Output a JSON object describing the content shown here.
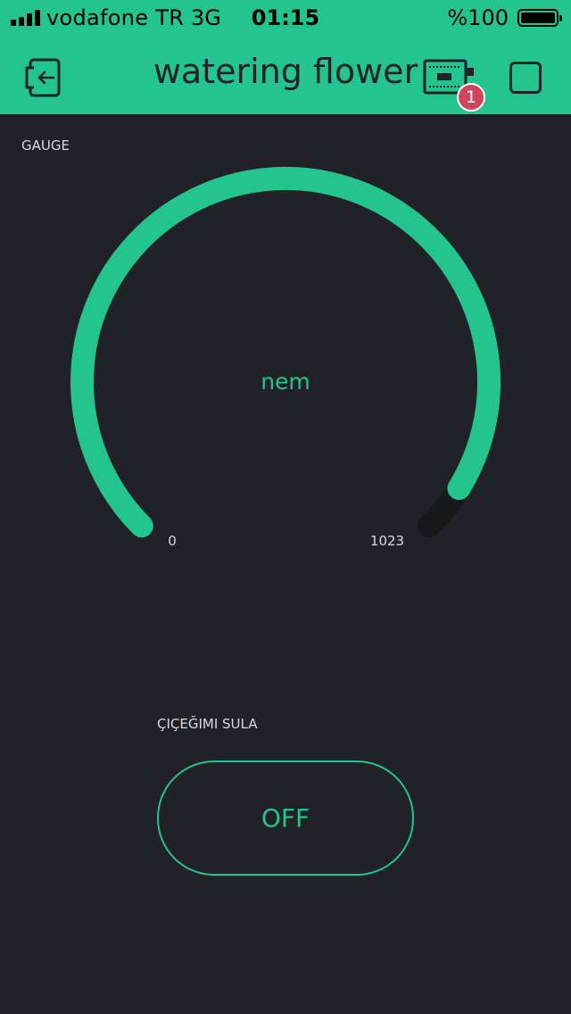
{
  "status_bar": {
    "carrier": "vodafone TR",
    "network": "3G",
    "time": "01:15",
    "battery_percent": "%100"
  },
  "header": {
    "title": "watering flower",
    "notification_count": "1"
  },
  "gauge": {
    "label": "GAUGE",
    "value_label": "nem",
    "min_label": "0",
    "max_label": "1023",
    "min": 0,
    "max": 1023,
    "fill_fraction": 0.95,
    "accent_color": "#23c48e",
    "track_color": "#17181c"
  },
  "switch": {
    "label": "ÇIÇEĞIMI SULA",
    "state": "OFF"
  },
  "colors": {
    "accent": "#23c48e",
    "background": "#212227",
    "badge": "#d3435c"
  }
}
